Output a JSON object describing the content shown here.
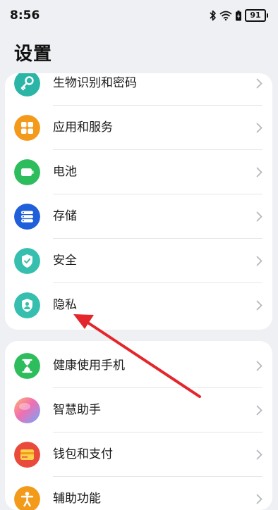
{
  "status_bar": {
    "time": "8:56",
    "battery": "91",
    "icons": [
      "bluetooth-icon",
      "wifi-icon",
      "battery-saver-icon",
      "battery-icon"
    ]
  },
  "page": {
    "title": "设置"
  },
  "group1": {
    "items": [
      {
        "label": "生物识别和密码",
        "icon": "key-icon",
        "color": "#2bb5a6"
      },
      {
        "label": "应用和服务",
        "icon": "apps-grid-icon",
        "color": "#f39a1b"
      },
      {
        "label": "电池",
        "icon": "battery-icon",
        "color": "#2ebd5c"
      },
      {
        "label": "存储",
        "icon": "storage-icon",
        "color": "#1f5fd9"
      },
      {
        "label": "安全",
        "icon": "shield-check-icon",
        "color": "#36bfae"
      },
      {
        "label": "隐私",
        "icon": "privacy-shield-icon",
        "color": "#36bfae"
      }
    ]
  },
  "group2": {
    "items": [
      {
        "label": "健康使用手机",
        "icon": "hourglass-icon",
        "color": "#2ebd5c"
      },
      {
        "label": "智慧助手",
        "icon": "assistant-orb-icon",
        "color": "#f08bb8"
      },
      {
        "label": "钱包和支付",
        "icon": "wallet-icon",
        "color": "#e94a3b"
      },
      {
        "label": "辅助功能",
        "icon": "accessibility-icon",
        "color": "#f39a1b"
      }
    ]
  },
  "annotation": {
    "arrow_color": "#e3262c"
  }
}
